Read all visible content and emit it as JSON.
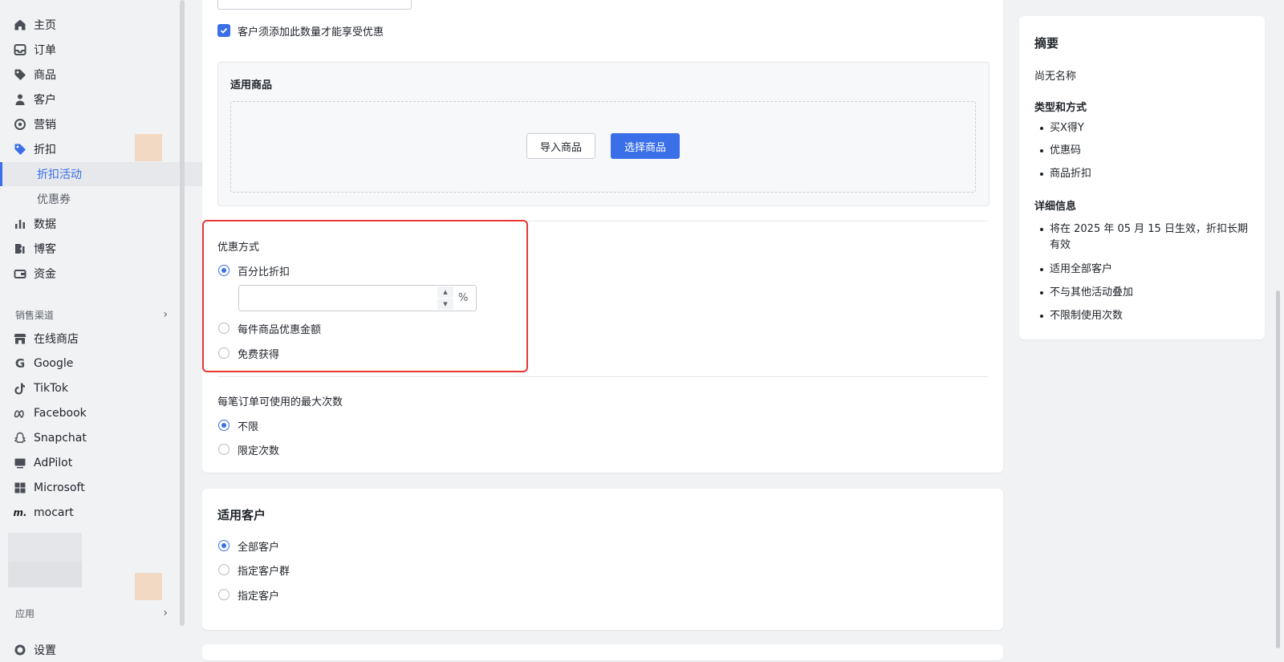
{
  "sidebar": {
    "items": [
      {
        "label": "主页",
        "icon": "home-icon"
      },
      {
        "label": "订单",
        "icon": "inbox-icon"
      },
      {
        "label": "商品",
        "icon": "tag-icon"
      },
      {
        "label": "客户",
        "icon": "person-icon"
      },
      {
        "label": "营销",
        "icon": "target-icon"
      },
      {
        "label": "折扣",
        "icon": "discount-tag-icon"
      },
      {
        "label": "折扣活动",
        "sub": true,
        "active": true
      },
      {
        "label": "优惠券",
        "sub": true
      },
      {
        "label": "数据",
        "icon": "bar-chart-icon"
      },
      {
        "label": "博客",
        "icon": "blog-icon"
      },
      {
        "label": "资金",
        "icon": "wallet-icon"
      }
    ],
    "channels_group": "销售渠道",
    "channels": [
      {
        "label": "在线商店",
        "icon": "store-icon"
      },
      {
        "label": "Google",
        "icon": "google-icon"
      },
      {
        "label": "TikTok",
        "icon": "tiktok-icon"
      },
      {
        "label": "Facebook",
        "icon": "meta-icon"
      },
      {
        "label": "Snapchat",
        "icon": "snapchat-icon"
      },
      {
        "label": "AdPilot",
        "icon": "adpilot-icon"
      },
      {
        "label": "Microsoft",
        "icon": "microsoft-icon"
      },
      {
        "label": "mocart",
        "icon": "mocart-icon"
      }
    ],
    "apps_group": "应用",
    "settings_label": "设置"
  },
  "main": {
    "min_qty_checkbox": {
      "label": "客户须添加此数量才能享受优惠",
      "checked": true
    },
    "applicable_products": {
      "title": "适用商品",
      "import_button": "导入商品",
      "select_button": "选择商品"
    },
    "discount_method": {
      "title": "优惠方式",
      "options": [
        {
          "label": "百分比折扣",
          "selected": true
        },
        {
          "label": "每件商品优惠金额",
          "selected": false
        },
        {
          "label": "免费获得",
          "selected": false
        }
      ],
      "percent_input": {
        "value": "",
        "unit": "%"
      }
    },
    "max_uses": {
      "title": "每笔订单可使用的最大次数",
      "options": [
        {
          "label": "不限",
          "selected": true
        },
        {
          "label": "限定次数",
          "selected": false
        }
      ]
    },
    "customers": {
      "title": "适用客户",
      "options": [
        {
          "label": "全部客户",
          "selected": true
        },
        {
          "label": "指定客户群",
          "selected": false
        },
        {
          "label": "指定客户",
          "selected": false
        }
      ]
    }
  },
  "summary": {
    "title": "摘要",
    "name": "尚无名称",
    "type_title": "类型和方式",
    "type_items": [
      "买X得Y",
      "优惠码",
      "商品折扣"
    ],
    "detail_title": "详细信息",
    "detail_items": [
      "将在 2025 年 05 月 15 日生效，折扣长期有效",
      "适用全部客户",
      "不与其他活动叠加",
      "不限制使用次数"
    ]
  },
  "colors": {
    "accent": "#3a6fe8",
    "highlight_border": "#e53935"
  }
}
